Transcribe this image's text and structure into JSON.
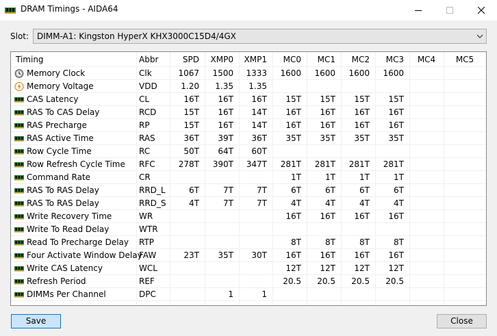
{
  "window": {
    "title": "DRAM Timings - AIDA64",
    "icons": {
      "app": "ram-module-icon",
      "minimize": "minimize-icon",
      "maximize": "maximize-icon",
      "close": "close-icon"
    }
  },
  "slot": {
    "label": "Slot:",
    "value": "DIMM-A1: Kingston HyperX KHX3000C15D4/4GX"
  },
  "table": {
    "headers": [
      "Timing",
      "Abbr",
      "SPD",
      "XMP0",
      "XMP1",
      "MC0",
      "MC1",
      "MC2",
      "MC3",
      "MC4",
      "MC5"
    ],
    "rows": [
      {
        "icon": "clock-icon",
        "cells": [
          "Memory Clock",
          "Clk",
          "1067",
          "1500",
          "1333",
          "1600",
          "1600",
          "1600",
          "1600",
          "",
          ""
        ]
      },
      {
        "icon": "lightning-icon",
        "cells": [
          "Memory Voltage",
          "VDD",
          "1.20",
          "1.35",
          "1.35",
          "",
          "",
          "",
          "",
          "",
          ""
        ]
      },
      {
        "icon": "ram-module-icon",
        "cells": [
          "CAS Latency",
          "CL",
          "16T",
          "16T",
          "16T",
          "15T",
          "15T",
          "15T",
          "15T",
          "",
          ""
        ]
      },
      {
        "icon": "ram-module-icon",
        "cells": [
          "RAS To CAS Delay",
          "RCD",
          "15T",
          "16T",
          "14T",
          "16T",
          "16T",
          "16T",
          "16T",
          "",
          ""
        ]
      },
      {
        "icon": "ram-module-icon",
        "cells": [
          "RAS Precharge",
          "RP",
          "15T",
          "16T",
          "14T",
          "16T",
          "16T",
          "16T",
          "16T",
          "",
          ""
        ]
      },
      {
        "icon": "ram-module-icon",
        "cells": [
          "RAS Active Time",
          "RAS",
          "36T",
          "39T",
          "36T",
          "35T",
          "35T",
          "35T",
          "35T",
          "",
          ""
        ]
      },
      {
        "icon": "ram-module-icon",
        "cells": [
          "Row Cycle Time",
          "RC",
          "50T",
          "64T",
          "60T",
          "",
          "",
          "",
          "",
          "",
          ""
        ]
      },
      {
        "icon": "ram-module-icon",
        "cells": [
          "Row Refresh Cycle Time",
          "RFC",
          "278T",
          "390T",
          "347T",
          "281T",
          "281T",
          "281T",
          "281T",
          "",
          ""
        ]
      },
      {
        "icon": "ram-module-icon",
        "cells": [
          "Command Rate",
          "CR",
          "",
          "",
          "",
          "1T",
          "1T",
          "1T",
          "1T",
          "",
          ""
        ]
      },
      {
        "icon": "ram-module-icon",
        "cells": [
          "RAS To RAS Delay",
          "RRD_L",
          "6T",
          "7T",
          "7T",
          "6T",
          "6T",
          "6T",
          "6T",
          "",
          ""
        ]
      },
      {
        "icon": "ram-module-icon",
        "cells": [
          "RAS To RAS Delay",
          "RRD_S",
          "4T",
          "7T",
          "7T",
          "4T",
          "4T",
          "4T",
          "4T",
          "",
          ""
        ]
      },
      {
        "icon": "ram-module-icon",
        "cells": [
          "Write Recovery Time",
          "WR",
          "",
          "",
          "",
          "16T",
          "16T",
          "16T",
          "16T",
          "",
          ""
        ]
      },
      {
        "icon": "ram-module-icon",
        "cells": [
          "Write To Read Delay",
          "WTR",
          "",
          "",
          "",
          "",
          "",
          "",
          "",
          "",
          ""
        ]
      },
      {
        "icon": "ram-module-icon",
        "cells": [
          "Read To Precharge Delay",
          "RTP",
          "",
          "",
          "",
          "8T",
          "8T",
          "8T",
          "8T",
          "",
          ""
        ]
      },
      {
        "icon": "ram-module-icon",
        "cells": [
          "Four Activate Window Delay",
          "FAW",
          "23T",
          "35T",
          "30T",
          "16T",
          "16T",
          "16T",
          "16T",
          "",
          ""
        ]
      },
      {
        "icon": "ram-module-icon",
        "cells": [
          "Write CAS Latency",
          "WCL",
          "",
          "",
          "",
          "12T",
          "12T",
          "12T",
          "12T",
          "",
          ""
        ]
      },
      {
        "icon": "ram-module-icon",
        "cells": [
          "Refresh Period",
          "REF",
          "",
          "",
          "",
          "20.5",
          "20.5",
          "20.5",
          "20.5",
          "",
          ""
        ]
      },
      {
        "icon": "ram-module-icon",
        "cells": [
          "DIMMs Per Channel",
          "DPC",
          "",
          "1",
          "1",
          "",
          "",
          "",
          "",
          "",
          ""
        ]
      }
    ]
  },
  "buttons": {
    "save": "Save",
    "close": "Close"
  }
}
